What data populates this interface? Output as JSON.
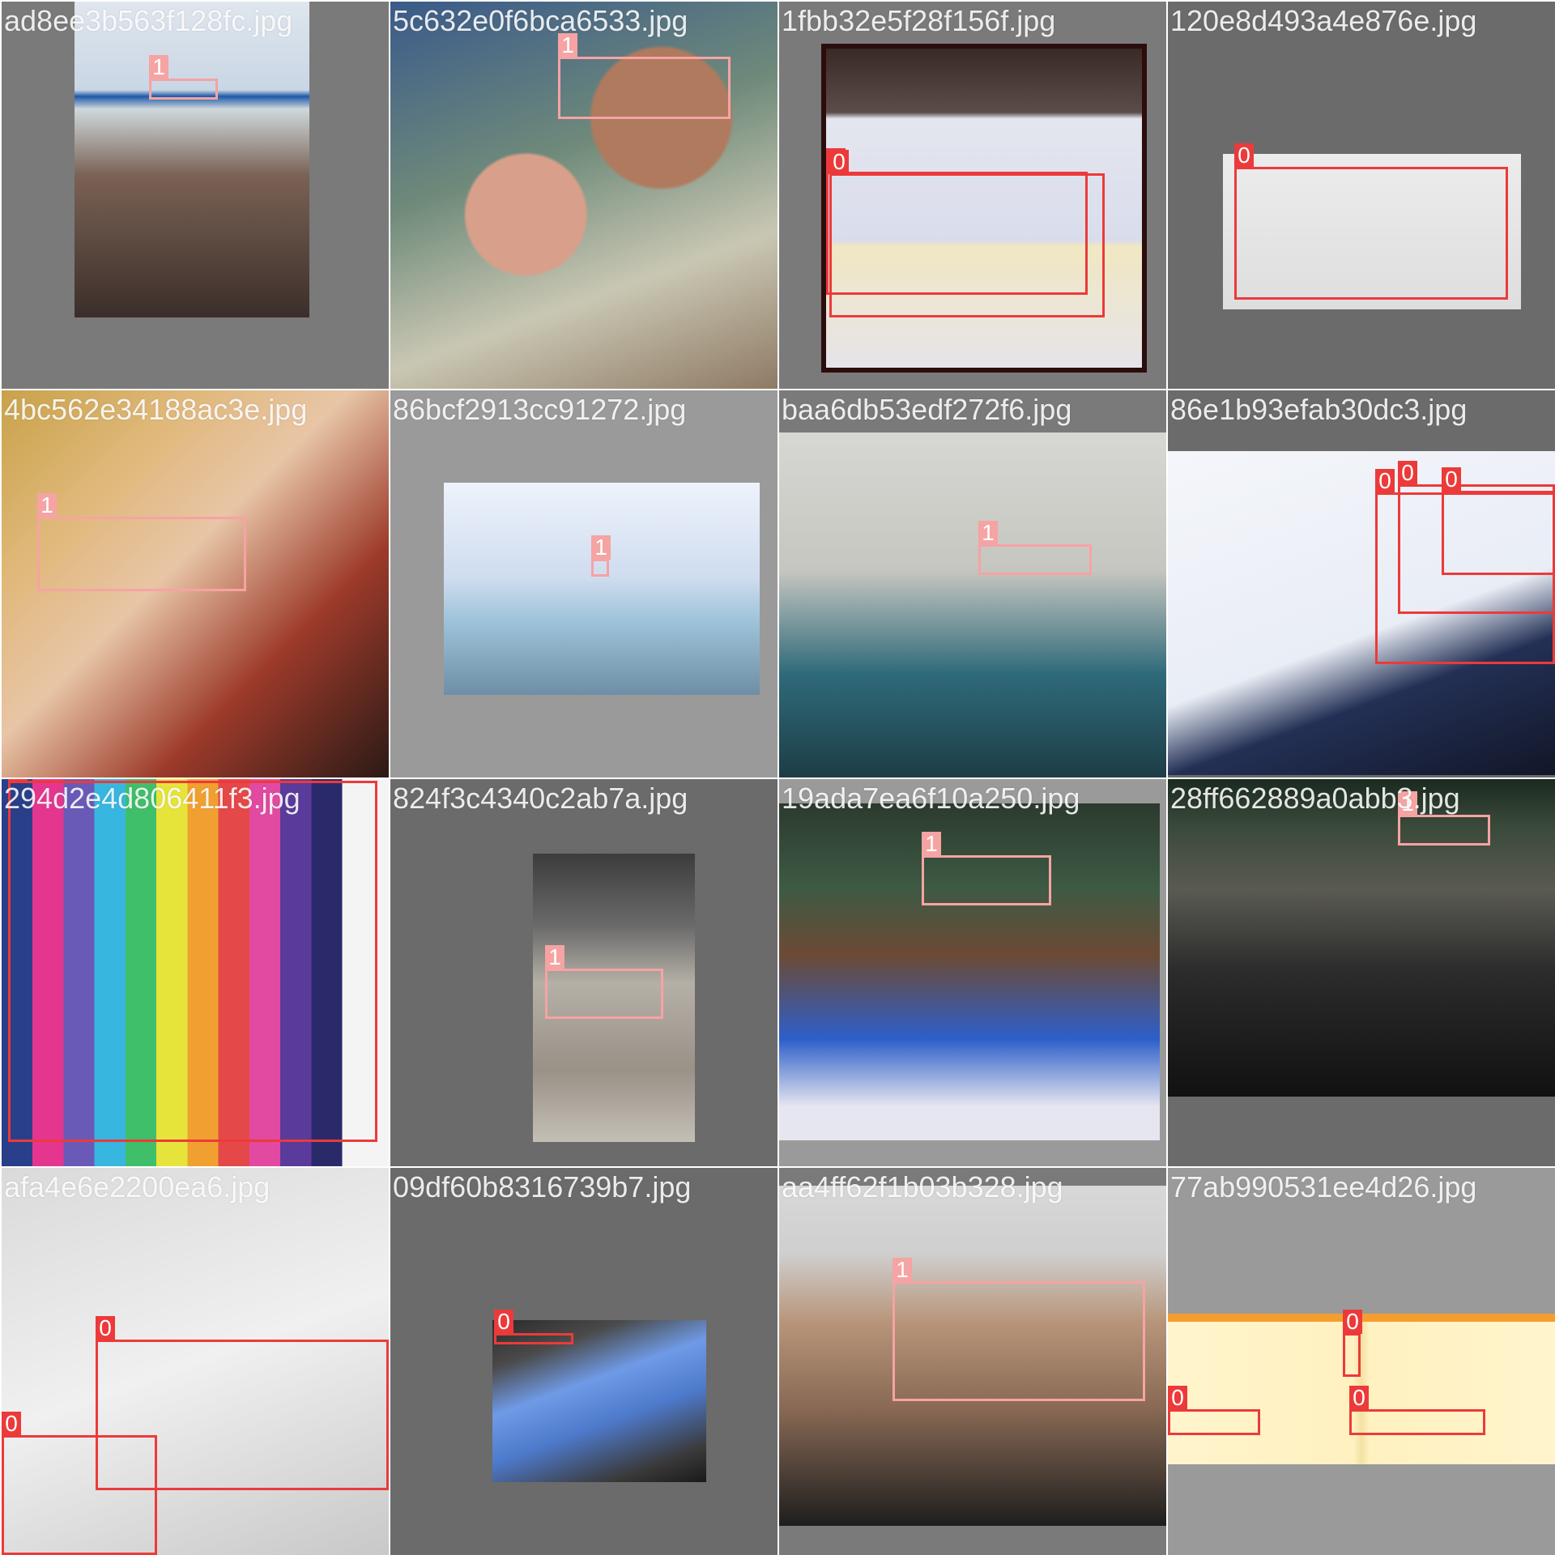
{
  "title": "",
  "colors": {
    "class_0": "#ec3a3a",
    "class_1": "#f6a3a3",
    "label_text": "#ffffff",
    "tile_bg_dark": "#6b6b6b",
    "tile_bg_mid": "#7a7a7a",
    "tile_bg_light": "#9a9a9a"
  },
  "tiles": [
    {
      "filename": "ad8ee3b563f128fc.jpg",
      "boxes": [
        {
          "cls": "1"
        }
      ]
    },
    {
      "filename": "5c632e0f6bca6533.jpg",
      "boxes": [
        {
          "cls": "1"
        }
      ]
    },
    {
      "filename": "1fbb32e5f28f156f.jpg",
      "boxes": [
        {
          "cls": "0"
        },
        {
          "cls": "0"
        }
      ]
    },
    {
      "filename": "120e8d493a4e876e.jpg",
      "boxes": [
        {
          "cls": "0"
        }
      ]
    },
    {
      "filename": "4bc562e34188ac3e.jpg",
      "boxes": [
        {
          "cls": "1"
        }
      ]
    },
    {
      "filename": "86bcf2913cc91272.jpg",
      "boxes": [
        {
          "cls": "1"
        }
      ]
    },
    {
      "filename": "baa6db53edf272f6.jpg",
      "boxes": [
        {
          "cls": "1"
        }
      ]
    },
    {
      "filename": "86e1b93efab30dc3.jpg",
      "boxes": [
        {
          "cls": "0"
        },
        {
          "cls": "0"
        },
        {
          "cls": "0"
        }
      ]
    },
    {
      "filename": "294d2e4d806411f3.jpg",
      "boxes": [
        {
          "cls": "0"
        }
      ]
    },
    {
      "filename": "824f3c4340c2ab7a.jpg",
      "boxes": [
        {
          "cls": "1"
        }
      ]
    },
    {
      "filename": "19ada7ea6f10a250.jpg",
      "boxes": [
        {
          "cls": "1"
        }
      ]
    },
    {
      "filename": "28ff662889a0abb3.jpg",
      "boxes": [
        {
          "cls": "1"
        }
      ]
    },
    {
      "filename": "afa4e6e2200ea6.jpg",
      "boxes": [
        {
          "cls": "0"
        },
        {
          "cls": "0"
        }
      ]
    },
    {
      "filename": "09df60b8316739b7.jpg",
      "boxes": [
        {
          "cls": "0"
        }
      ]
    },
    {
      "filename": "aa4ff62f1b03b328.jpg",
      "boxes": [
        {
          "cls": "1"
        }
      ]
    },
    {
      "filename": "77ab990531ee4d26.jpg",
      "boxes": [
        {
          "cls": "0"
        },
        {
          "cls": "0"
        },
        {
          "cls": "0"
        }
      ]
    }
  ]
}
